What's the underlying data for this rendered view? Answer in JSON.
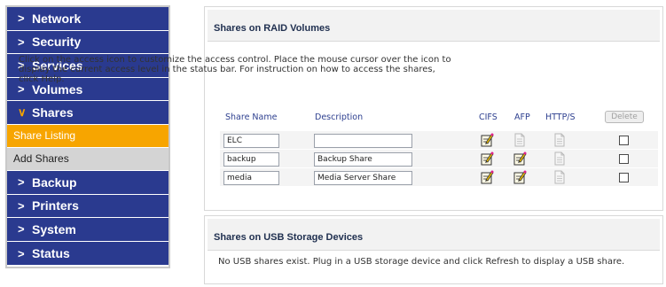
{
  "sidebar": {
    "items_top": [
      {
        "label": "Network",
        "icon": "chevron-right-icon"
      },
      {
        "label": "Security",
        "icon": "chevron-right-icon"
      },
      {
        "label": "Services",
        "icon": "chevron-right-icon"
      },
      {
        "label": "Volumes",
        "icon": "chevron-right-icon"
      },
      {
        "label": "Shares",
        "icon": "chevron-down-icon"
      }
    ],
    "sub_items": [
      {
        "label": "Share Listing",
        "active": true
      },
      {
        "label": "Add Shares",
        "active": false
      }
    ],
    "items_bottom": [
      {
        "label": "Backup",
        "icon": "chevron-right-icon"
      },
      {
        "label": "Printers",
        "icon": "chevron-right-icon"
      },
      {
        "label": "System",
        "icon": "chevron-right-icon"
      },
      {
        "label": "Status",
        "icon": "chevron-right-icon"
      }
    ],
    "chevron_right": ">",
    "chevron_down": "∨"
  },
  "raid": {
    "title": "Shares on RAID Volumes",
    "intro": "Click on the access icon to customize the access control. Place the mouse cursor over the icon to display the current access level in the status bar. For instruction on how to access the shares, click Help.",
    "columns": {
      "name": "Share Name",
      "description": "Description",
      "cifs": "CIFS",
      "afp": "AFP",
      "http": "HTTP/S"
    },
    "delete_label": "Delete",
    "rows": [
      {
        "name": "ELC",
        "description": "",
        "cifs": "edit-enabled",
        "afp": "page-disabled",
        "http": "page-disabled",
        "checked": false
      },
      {
        "name": "backup",
        "description": "Backup Share",
        "cifs": "edit-enabled",
        "afp": "edit-enabled",
        "http": "page-disabled",
        "checked": false
      },
      {
        "name": "media",
        "description": "Media Server Share",
        "cifs": "edit-enabled",
        "afp": "edit-enabled",
        "http": "page-disabled",
        "checked": false
      }
    ]
  },
  "usb": {
    "title": "Shares on USB Storage Devices",
    "message": "No USB shares exist. Plug in a USB storage device and click Refresh to display a USB share."
  },
  "colors": {
    "nav_bg": "#2a3a8f",
    "active_sub": "#f7a500",
    "inactive_sub": "#d4d4d4",
    "header_text": "#1f2f4f"
  }
}
